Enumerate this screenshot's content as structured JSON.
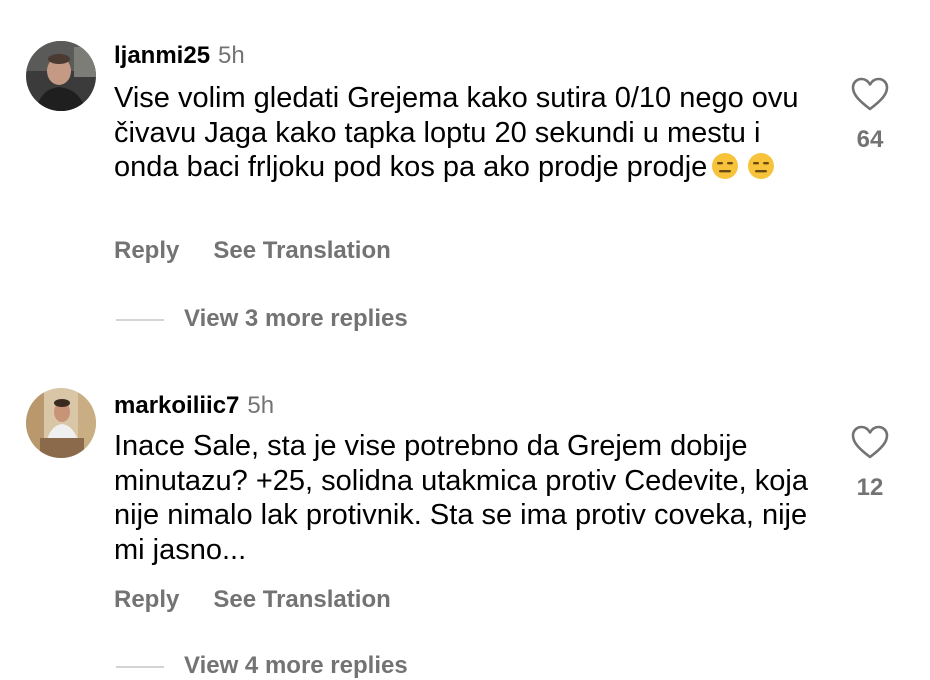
{
  "comments": [
    {
      "username": "ljanmi25",
      "time": "5h",
      "text": "Vise volim gledati Grejema kako sutira 0/10 nego ovu čivavu Jaga kako tapka loptu 20 sekundi u mestu i onda baci frljoku pod kos pa ako prodje prodje",
      "emojis": [
        "expressionless-face",
        "expressionless-face"
      ],
      "likes": "64",
      "reply_label": "Reply",
      "translate_label": "See Translation",
      "view_replies": "View 3 more replies"
    },
    {
      "username": "markoiliic7",
      "time": "5h",
      "text": "Inace Sale, sta je vise potrebno da Grejem dobije minutazu? +25, solidna utakmica protiv Cedevite, koja nije nimalo lak protivnik. Sta se ima protiv coveka, nije mi jasno...",
      "emojis": [],
      "likes": "12",
      "reply_label": "Reply",
      "translate_label": "See Translation",
      "view_replies": "View 4 more replies"
    }
  ],
  "colors": {
    "secondary_text": "#737373",
    "reply_line": "#d4d4d4",
    "emoji_face": "#f7c33b"
  },
  "icons": {
    "like": "heart-outline-icon"
  }
}
